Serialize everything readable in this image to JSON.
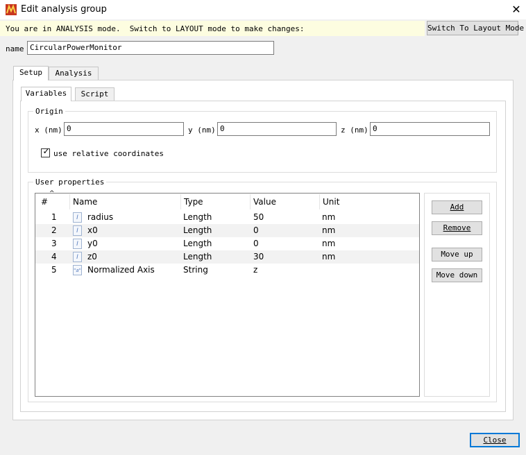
{
  "window": {
    "title": "Edit analysis group",
    "close_glyph": "✕"
  },
  "mode_banner": {
    "text": "You are in ANALYSIS mode.  Switch to LAYOUT mode to make changes:",
    "button": "Switch To Layout Mode"
  },
  "name_field": {
    "label": "name",
    "value": "CircularPowerMonitor"
  },
  "outer_tabs": [
    {
      "label": "Setup",
      "active": true
    },
    {
      "label": "Analysis",
      "active": false
    }
  ],
  "inner_tabs": [
    {
      "label": "Variables",
      "active": true
    },
    {
      "label": "Script",
      "active": false
    }
  ],
  "origin": {
    "title": "Origin",
    "x": {
      "label": "x (nm)",
      "value": "0"
    },
    "y": {
      "label": "y (nm)",
      "value": "0"
    },
    "z": {
      "label": "z (nm)",
      "value": "0"
    },
    "relative": {
      "label": "use relative coordinates",
      "checked": true,
      "mark": "✓"
    }
  },
  "user_properties": {
    "title": "User properties",
    "columns": [
      "#",
      "Name",
      "Type",
      "Value",
      "Unit"
    ],
    "sort_glyph": "^",
    "rows": [
      {
        "num": "1",
        "icon": "I",
        "name": "radius",
        "type": "Length",
        "value": "50",
        "unit": "nm"
      },
      {
        "num": "2",
        "icon": "I",
        "name": "x0",
        "type": "Length",
        "value": "0",
        "unit": "nm"
      },
      {
        "num": "3",
        "icon": "I",
        "name": "y0",
        "type": "Length",
        "value": "0",
        "unit": "nm"
      },
      {
        "num": "4",
        "icon": "I",
        "name": "z0",
        "type": "Length",
        "value": "30",
        "unit": "nm"
      },
      {
        "num": "5",
        "icon": "\"a\"",
        "name": "Normalized Axis",
        "type": "String",
        "value": "z",
        "unit": ""
      }
    ],
    "buttons": {
      "add": "Add",
      "remove": "Remove",
      "move_up": "Move up",
      "move_down": "Move down"
    }
  },
  "footer": {
    "close": "Close"
  },
  "colors": {
    "banner_bg": "#fdfde0",
    "alt_row": "#f2f2f2",
    "focus_border": "#0078d7"
  }
}
